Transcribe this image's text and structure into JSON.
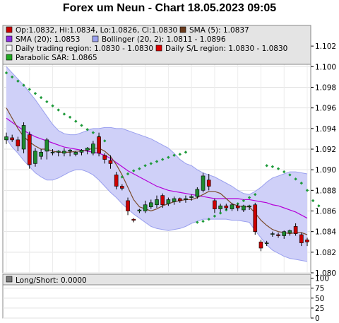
{
  "title": "Forex um Neun - Chart 18.05.2023 09:05",
  "legend": [
    {
      "text": "Op:1.0832, Hi:1.0834, Lo:1.0826, Cl:1.0830",
      "color": "#cc0000"
    },
    {
      "text": "SMA (5): 1.0837",
      "color": "#6b3d1e"
    },
    {
      "text": "SMA (20): 1.0853",
      "color": "#8a2be2"
    },
    {
      "text": "Bollinger (20, 2): 1.0811 - 1.0896",
      "color": "#9aa0ee"
    },
    {
      "text": "Daily trading region: 1.0830 - 1.0830",
      "color": "#ffffff"
    },
    {
      "text": "Daily S/L region: 1.0830 - 1.0830",
      "color": "#dd0000"
    },
    {
      "text": "Parabolic SAR: 1.0865",
      "color": "#22aa22"
    }
  ],
  "sub_legend": {
    "text": "Long/Short: 0.0000",
    "color": "#777777"
  },
  "chart_data": [
    {
      "type": "candlestick",
      "title": "Forex um Neun - Chart 18.05.2023 09:05",
      "ylim": [
        1.08,
        1.104
      ],
      "y_ticks": [
        "1.080",
        "1.082",
        "1.084",
        "1.086",
        "1.088",
        "1.090",
        "1.092",
        "1.094",
        "1.096",
        "1.098",
        "1.100",
        "1.102"
      ],
      "grid": true,
      "legend_position": "top",
      "candles": [
        {
          "o": 1.0929,
          "h": 1.0936,
          "l": 1.0925,
          "c": 1.0932
        },
        {
          "o": 1.0931,
          "h": 1.0934,
          "l": 1.0927,
          "c": 1.0929
        },
        {
          "o": 1.0929,
          "h": 1.0932,
          "l": 1.0918,
          "c": 1.0923
        },
        {
          "o": 1.092,
          "h": 1.0946,
          "l": 1.0916,
          "c": 1.0943
        },
        {
          "o": 1.0934,
          "h": 1.0937,
          "l": 1.0901,
          "c": 1.0905
        },
        {
          "o": 1.0906,
          "h": 1.0921,
          "l": 1.0903,
          "c": 1.0918
        },
        {
          "o": 1.0913,
          "h": 1.092,
          "l": 1.091,
          "c": 1.0917
        },
        {
          "o": 1.0918,
          "h": 1.0931,
          "l": 1.091,
          "c": 1.0929
        },
        {
          "o": 1.0917,
          "h": 1.092,
          "l": 1.0914,
          "c": 1.0917
        },
        {
          "o": 1.0917,
          "h": 1.0919,
          "l": 1.0913,
          "c": 1.0918
        },
        {
          "o": 1.0916,
          "h": 1.0921,
          "l": 1.0913,
          "c": 1.0918
        },
        {
          "o": 1.0918,
          "h": 1.092,
          "l": 1.0913,
          "c": 1.0919
        },
        {
          "o": 1.0915,
          "h": 1.0918,
          "l": 1.0913,
          "c": 1.0917
        },
        {
          "o": 1.0917,
          "h": 1.092,
          "l": 1.0914,
          "c": 1.0919
        },
        {
          "o": 1.0919,
          "h": 1.0922,
          "l": 1.0915,
          "c": 1.0921
        },
        {
          "o": 1.0916,
          "h": 1.0928,
          "l": 1.0914,
          "c": 1.0925
        },
        {
          "o": 1.0932,
          "h": 1.0936,
          "l": 1.0913,
          "c": 1.0916
        },
        {
          "o": 1.0914,
          "h": 1.0916,
          "l": 1.0906,
          "c": 1.091
        },
        {
          "o": 1.0909,
          "h": 1.0914,
          "l": 1.0901,
          "c": 1.0906
        },
        {
          "o": 1.0895,
          "h": 1.0898,
          "l": 1.0881,
          "c": 1.0884
        },
        {
          "o": 1.0884,
          "h": 1.0886,
          "l": 1.088,
          "c": 1.0882
        },
        {
          "o": 1.087,
          "h": 1.0873,
          "l": 1.0856,
          "c": 1.086
        },
        {
          "o": 1.0852,
          "h": 1.0853,
          "l": 1.0849,
          "c": 1.0851
        },
        {
          "o": 1.086,
          "h": 1.0862,
          "l": 1.0858,
          "c": 1.0861
        },
        {
          "o": 1.086,
          "h": 1.087,
          "l": 1.0858,
          "c": 1.0866
        },
        {
          "o": 1.0864,
          "h": 1.0871,
          "l": 1.0862,
          "c": 1.0868
        },
        {
          "o": 1.0866,
          "h": 1.0875,
          "l": 1.0863,
          "c": 1.0871
        },
        {
          "o": 1.0875,
          "h": 1.0877,
          "l": 1.0863,
          "c": 1.0866
        },
        {
          "o": 1.0867,
          "h": 1.0873,
          "l": 1.0865,
          "c": 1.0871
        },
        {
          "o": 1.0869,
          "h": 1.0874,
          "l": 1.0866,
          "c": 1.0872
        },
        {
          "o": 1.0872,
          "h": 1.0873,
          "l": 1.0868,
          "c": 1.087
        },
        {
          "o": 1.0871,
          "h": 1.0875,
          "l": 1.0868,
          "c": 1.0872
        },
        {
          "o": 1.0873,
          "h": 1.0876,
          "l": 1.087,
          "c": 1.0874
        },
        {
          "o": 1.0874,
          "h": 1.0883,
          "l": 1.0872,
          "c": 1.0881
        },
        {
          "o": 1.088,
          "h": 1.0897,
          "l": 1.0878,
          "c": 1.0894
        },
        {
          "o": 1.089,
          "h": 1.0896,
          "l": 1.088,
          "c": 1.0884
        },
        {
          "o": 1.087,
          "h": 1.0872,
          "l": 1.0858,
          "c": 1.0862
        },
        {
          "o": 1.0862,
          "h": 1.0867,
          "l": 1.0859,
          "c": 1.0865
        },
        {
          "o": 1.0865,
          "h": 1.0867,
          "l": 1.0861,
          "c": 1.0863
        },
        {
          "o": 1.0862,
          "h": 1.0868,
          "l": 1.086,
          "c": 1.0866
        },
        {
          "o": 1.0865,
          "h": 1.0867,
          "l": 1.086,
          "c": 1.0863
        },
        {
          "o": 1.0861,
          "h": 1.0866,
          "l": 1.0859,
          "c": 1.0865
        },
        {
          "o": 1.0864,
          "h": 1.0866,
          "l": 1.0861,
          "c": 1.0865
        },
        {
          "o": 1.0866,
          "h": 1.0868,
          "l": 1.0837,
          "c": 1.084
        },
        {
          "o": 1.083,
          "h": 1.0832,
          "l": 1.0821,
          "c": 1.0824
        },
        {
          "o": 1.0829,
          "h": 1.0831,
          "l": 1.0826,
          "c": 1.0829
        },
        {
          "o": 1.0838,
          "h": 1.084,
          "l": 1.0835,
          "c": 1.0838
        },
        {
          "o": 1.0837,
          "h": 1.0839,
          "l": 1.0834,
          "c": 1.0836
        },
        {
          "o": 1.0836,
          "h": 1.0841,
          "l": 1.0833,
          "c": 1.084
        },
        {
          "o": 1.0839,
          "h": 1.0842,
          "l": 1.0836,
          "c": 1.0841
        },
        {
          "o": 1.0845,
          "h": 1.0848,
          "l": 1.0836,
          "c": 1.0838
        },
        {
          "o": 1.0837,
          "h": 1.0839,
          "l": 1.0826,
          "c": 1.0829
        },
        {
          "o": 1.0832,
          "h": 1.0834,
          "l": 1.0826,
          "c": 1.083
        }
      ],
      "sma5": [
        1.096,
        1.095,
        1.094,
        1.0932,
        1.0927,
        1.0923,
        1.092,
        1.092,
        1.0918,
        1.0917,
        1.0917,
        1.0917,
        1.0918,
        1.0918,
        1.0919,
        1.0921,
        1.0921,
        1.0918,
        1.0913,
        1.0905,
        1.0895,
        1.0883,
        1.0871,
        1.0864,
        1.0862,
        1.086,
        1.0862,
        1.0865,
        1.0867,
        1.0869,
        1.087,
        1.0871,
        1.0871,
        1.0873,
        1.0876,
        1.0879,
        1.0879,
        1.0877,
        1.0872,
        1.0867,
        1.0865,
        1.0864,
        1.0864,
        1.0858,
        1.0851,
        1.0846,
        1.0842,
        1.084,
        1.0839,
        1.0838,
        1.0839,
        1.0839,
        1.0837
      ],
      "sma20": [
        1.095,
        1.0946,
        1.0942,
        1.0938,
        1.0935,
        1.0932,
        1.093,
        1.0928,
        1.0926,
        1.0924,
        1.0922,
        1.0921,
        1.092,
        1.0919,
        1.0918,
        1.0917,
        1.0916,
        1.0914,
        1.0911,
        1.0907,
        1.0903,
        1.0899,
        1.0896,
        1.0893,
        1.089,
        1.0887,
        1.0884,
        1.0882,
        1.088,
        1.0879,
        1.0878,
        1.0877,
        1.0876,
        1.0875,
        1.0874,
        1.0873,
        1.0872,
        1.0872,
        1.0872,
        1.0872,
        1.0872,
        1.0871,
        1.0871,
        1.087,
        1.0869,
        1.0868,
        1.0866,
        1.0865,
        1.0863,
        1.0861,
        1.0859,
        1.0856,
        1.0853
      ],
      "bollinger_upper": [
        1.1,
        1.0994,
        1.0988,
        1.0982,
        1.0975,
        1.0968,
        1.096,
        1.0952,
        1.0944,
        1.0938,
        1.0935,
        1.0934,
        1.0934,
        1.0936,
        1.0938,
        1.094,
        1.094,
        1.0941,
        1.0941,
        1.094,
        1.094,
        1.0938,
        1.0936,
        1.0934,
        1.0932,
        1.093,
        1.0927,
        1.0924,
        1.0921,
        1.0916,
        1.091,
        1.0906,
        1.0904,
        1.09,
        1.0897,
        1.0895,
        1.0893,
        1.089,
        1.0887,
        1.0884,
        1.088,
        1.0877,
        1.0876,
        1.0879,
        1.0883,
        1.0888,
        1.0892,
        1.0894,
        1.0896,
        1.0898,
        1.0898,
        1.0897,
        1.0896
      ],
      "bollinger_lower": [
        1.093,
        1.0922,
        1.0916,
        1.0909,
        1.0903,
        1.0897,
        1.0893,
        1.089,
        1.089,
        1.0892,
        1.0895,
        1.0898,
        1.09,
        1.09,
        1.0898,
        1.0895,
        1.089,
        1.0884,
        1.0878,
        1.0873,
        1.0867,
        1.0862,
        1.0857,
        1.0853,
        1.0849,
        1.0845,
        1.0843,
        1.0842,
        1.0841,
        1.0842,
        1.0843,
        1.0845,
        1.0848,
        1.085,
        1.0852,
        1.0852,
        1.0852,
        1.0852,
        1.0852,
        1.0851,
        1.0851,
        1.085,
        1.0849,
        1.0841,
        1.0834,
        1.0827,
        1.0822,
        1.0819,
        1.0816,
        1.0814,
        1.0813,
        1.0812,
        1.0811
      ],
      "parabolic_sar": [
        1.0994,
        1.099,
        1.0986,
        1.0982,
        1.0978,
        1.0974,
        1.097,
        1.0966,
        1.0962,
        1.0958,
        1.0954,
        1.0951,
        1.0947,
        1.0943,
        1.0939,
        1.0936,
        1.0932,
        1.0928,
        null,
        1.089,
        1.0893,
        1.0896,
        1.0899,
        1.0901,
        1.0904,
        1.0906,
        1.0908,
        1.091,
        1.0912,
        1.0914,
        1.0915,
        1.0917,
        null,
        1.0849,
        1.085,
        1.0852,
        1.0855,
        1.0858,
        1.0861,
        1.0864,
        1.0867,
        1.087,
        1.0873,
        1.0876,
        null,
        1.0904,
        1.0903,
        1.0901,
        1.0898,
        1.0895,
        1.0891,
        1.0887,
        1.088,
        1.087,
        1.0865
      ]
    },
    {
      "type": "line",
      "title": "Long/Short: 0.0000",
      "ylim": [
        0,
        110
      ],
      "y_ticks": [
        "0",
        "25",
        "50",
        "75",
        "100"
      ],
      "values": [
        0
      ]
    }
  ]
}
